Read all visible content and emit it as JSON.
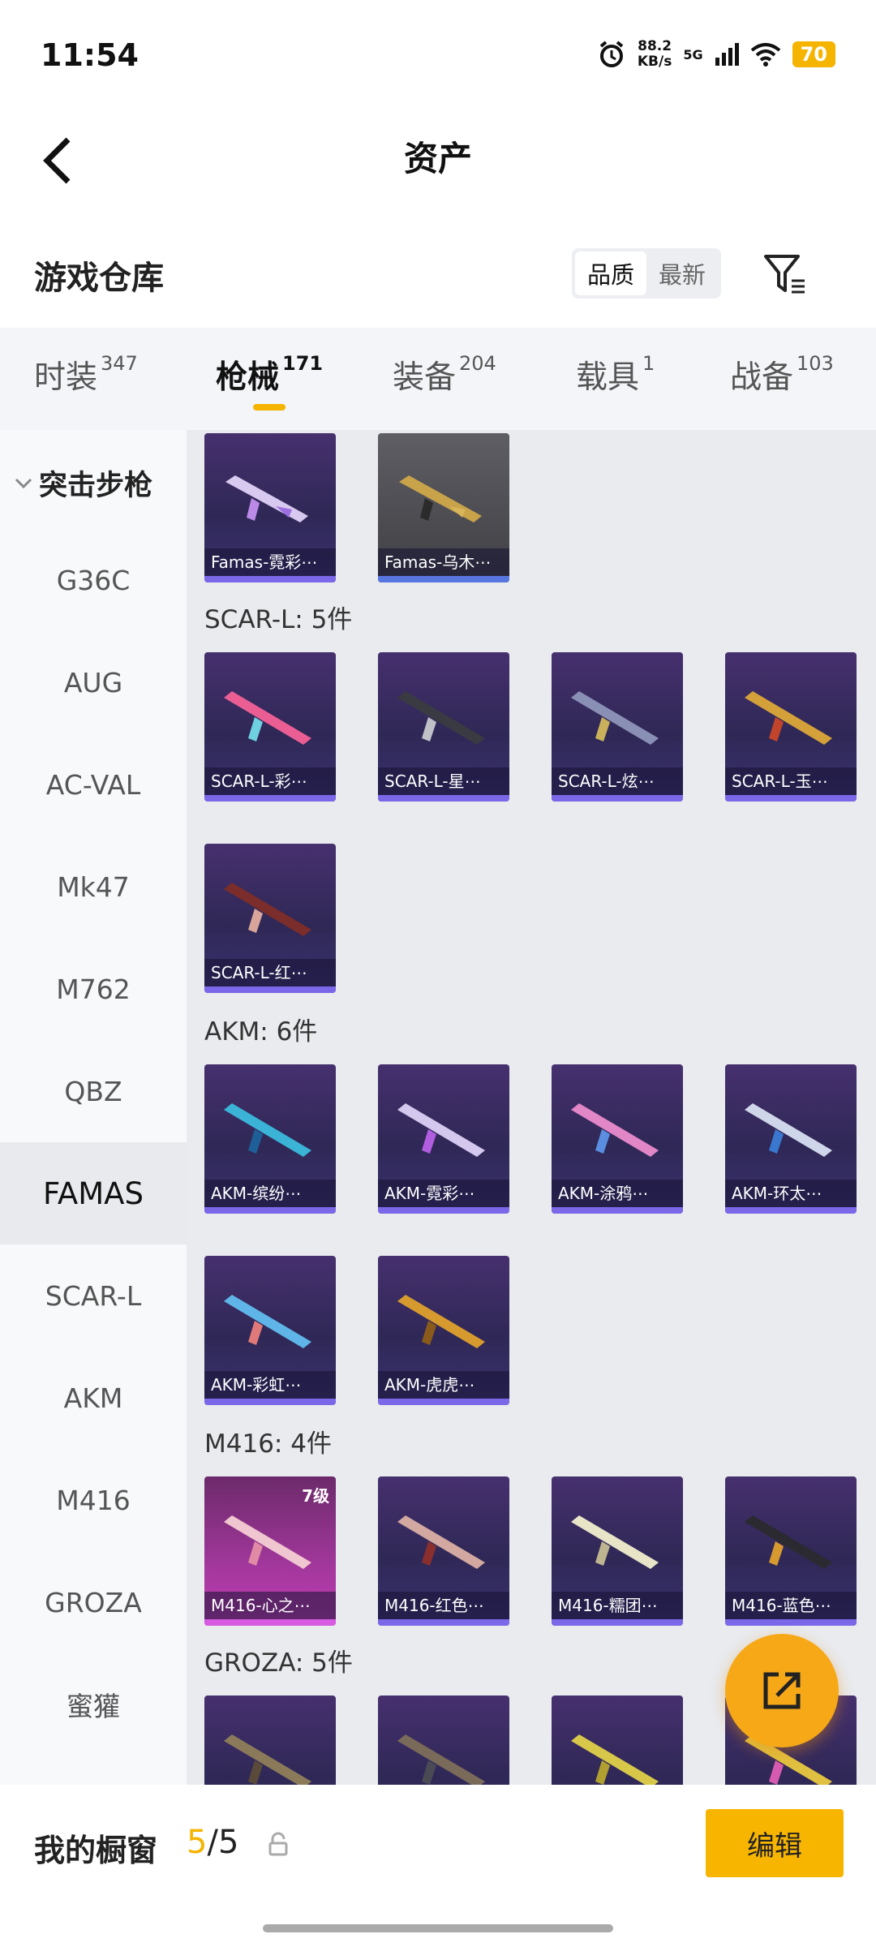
{
  "status_bar": {
    "time": "11:54",
    "net_speed_value": "88.2",
    "net_speed_unit": "KB/s",
    "net_type": "5G",
    "battery": "70"
  },
  "nav": {
    "title": "资产"
  },
  "header": {
    "title": "游戏仓库",
    "sort_options": [
      "品质",
      "最新"
    ]
  },
  "tabs": [
    {
      "label": "时装",
      "count": "347"
    },
    {
      "label": "枪械",
      "count": "171"
    },
    {
      "label": "装备",
      "count": "204"
    },
    {
      "label": "载具",
      "count": "1"
    },
    {
      "label": "战备",
      "count": "103"
    }
  ],
  "sidebar": {
    "group": "突击步枪",
    "items": [
      "G36C",
      "AUG",
      "AC-VAL",
      "Mk47",
      "M762",
      "QBZ",
      "FAMAS",
      "SCAR-L",
      "AKM",
      "M416",
      "GROZA",
      "蜜獾"
    ]
  },
  "sections": [
    {
      "heading": "",
      "cards": [
        "Famas-霓彩⋯",
        "Famas-乌木⋯"
      ]
    },
    {
      "heading": "SCAR-L: 5件",
      "cards": [
        "SCAR-L-彩⋯",
        "SCAR-L-星⋯",
        "SCAR-L-炫⋯",
        "SCAR-L-玉⋯",
        "SCAR-L-红⋯"
      ]
    },
    {
      "heading": "AKM: 6件",
      "cards": [
        "AKM-缤纷⋯",
        "AKM-霓彩⋯",
        "AKM-涂鸦⋯",
        "AKM-环太⋯",
        "AKM-彩虹⋯",
        "AKM-虎虎⋯"
      ]
    },
    {
      "heading": "M416: 4件",
      "cards": [
        "M416-心之⋯",
        "M416-红色⋯",
        "M416-糯团⋯",
        "M416-蓝色⋯"
      ],
      "level": "7级"
    },
    {
      "heading": "GROZA: 5件",
      "cards": []
    }
  ],
  "bottom": {
    "showcase_label": "我的橱窗",
    "showcase_current": "5",
    "showcase_sep": "/",
    "showcase_total": "5",
    "edit_label": "编辑"
  },
  "colors": {
    "accent": "#f4b400",
    "fab": "#f7a817"
  }
}
